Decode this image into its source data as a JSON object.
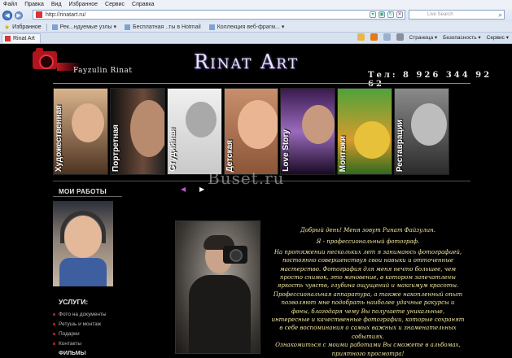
{
  "browser": {
    "menu": [
      "Файл",
      "Правка",
      "Вид",
      "Избранное",
      "Сервис",
      "Справка"
    ],
    "url": "http://rinatart.ru/",
    "search_placeholder": "Live Search",
    "favorites_label": "Избранное",
    "favorites": [
      {
        "label": "Рек...ндуемые узлы ▾"
      },
      {
        "label": "Бесплатная  ..ты в Hotmail"
      },
      {
        "label": "Коллекция веб-фрагм... ▾"
      }
    ],
    "tab_title": "Rinat Art",
    "commands": [
      "Страница ▾",
      "Безопасность ▾",
      "Сервис ▾"
    ]
  },
  "site": {
    "logo_text": "Fayzulin Rinat",
    "title": "Rinat Art",
    "phone": "Тел: 8 926 344 92 62",
    "gallery": [
      {
        "label": "Художественная"
      },
      {
        "label": "Портретная"
      },
      {
        "label": "Студийная"
      },
      {
        "label": "Детская"
      },
      {
        "label": "Love Story"
      },
      {
        "label": "Монтажи"
      },
      {
        "label": "Реставрации"
      }
    ],
    "watermark": "Buset.ru",
    "my_works_heading": "МОИ РАБОТЫ",
    "services_heading": "УСЛУГИ:",
    "services": [
      "Фото на документы",
      "Ретушь и монтаж",
      "Подарки",
      "Контакты"
    ],
    "bottom_heading": "ФИЛЬМЫ",
    "intro_lines": [
      "Добрый день! Меня зовут Ринат Файзулин.",
      "Я - профессиональный фотограф.",
      "На протяжении нескольких лет я занимаюсь фотографией,",
      "постоянно совершенствуя свои навыки и отточенные",
      "мастерство. Фотография для меня нечто большее, чем",
      "просто снимок, это мгновение, в котором запечатлены",
      "яркость чувств, глубина ощущений и максимум красоты.",
      "Профессиональная аппаратура, а также накопленный опыт",
      "позволяют мне подобрать наиболее удачные ракурсы и",
      "фоны, благодаря чему Вы получаете уникальные,",
      "интересные и качественные фотографии, которые сохранят",
      "в себе воспоминания о самых важных и знаменательных",
      "событиях.",
      "Ознакомиться с моими работами Вы сможете в альбомах,",
      "приятного просмотра!"
    ]
  },
  "colors": {
    "accent_red": "#b1141c",
    "intro_text": "#f2e6a0",
    "background": "#000000"
  }
}
